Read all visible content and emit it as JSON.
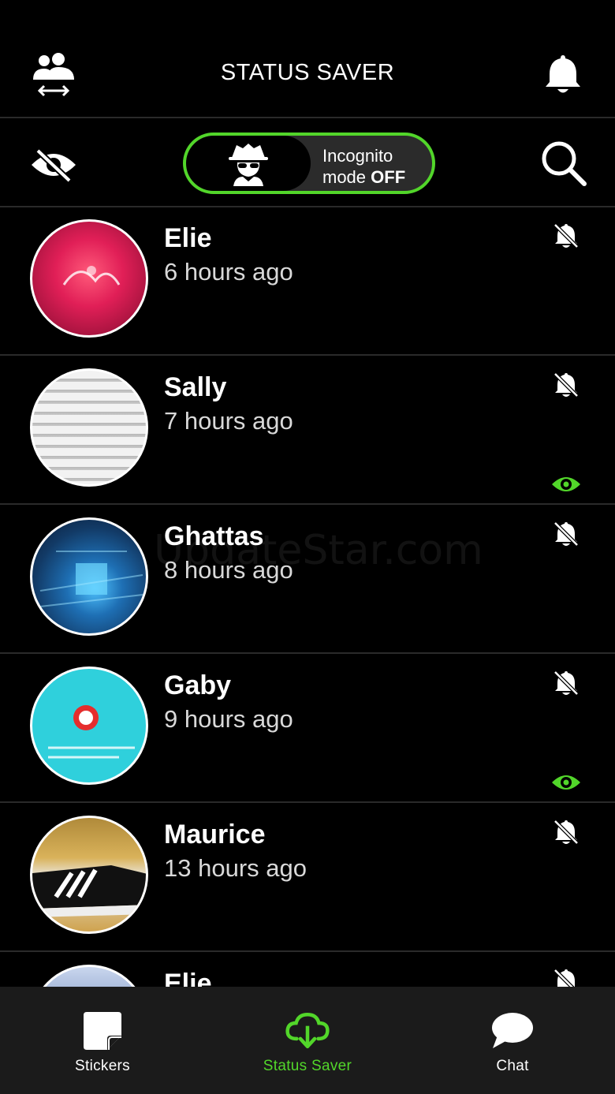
{
  "header": {
    "title": "STATUS SAVER",
    "left_icon": "switch-account-icon",
    "right_icon": "bell-icon"
  },
  "toolbar": {
    "hide_icon": "eye-slash-icon",
    "search_icon": "search-icon",
    "incognito": {
      "icon": "spy-icon",
      "line1": "Incognito",
      "line2_prefix": "mode ",
      "line2_state": "OFF"
    }
  },
  "colors": {
    "accent": "#52d62a",
    "background": "#000000",
    "tabbar": "#1b1b1b"
  },
  "statuses": [
    {
      "name": "Elie",
      "time": "6 hours ago",
      "muted": true,
      "seen": false
    },
    {
      "name": "Sally",
      "time": "7 hours ago",
      "muted": true,
      "seen": true
    },
    {
      "name": "Ghattas",
      "time": "8 hours ago",
      "muted": true,
      "seen": false
    },
    {
      "name": "Gaby",
      "time": "9 hours ago",
      "muted": true,
      "seen": true
    },
    {
      "name": "Maurice",
      "time": "13 hours ago",
      "muted": true,
      "seen": false
    },
    {
      "name": "Elie",
      "time": "",
      "muted": true,
      "seen": false
    }
  ],
  "tabs": [
    {
      "label": "Stickers",
      "icon": "sticker-icon",
      "active": false
    },
    {
      "label": "Status Saver",
      "icon": "cloud-download-icon",
      "active": true
    },
    {
      "label": "Chat",
      "icon": "chat-bubble-icon",
      "active": false
    }
  ],
  "watermark": "UpdateStar.com"
}
